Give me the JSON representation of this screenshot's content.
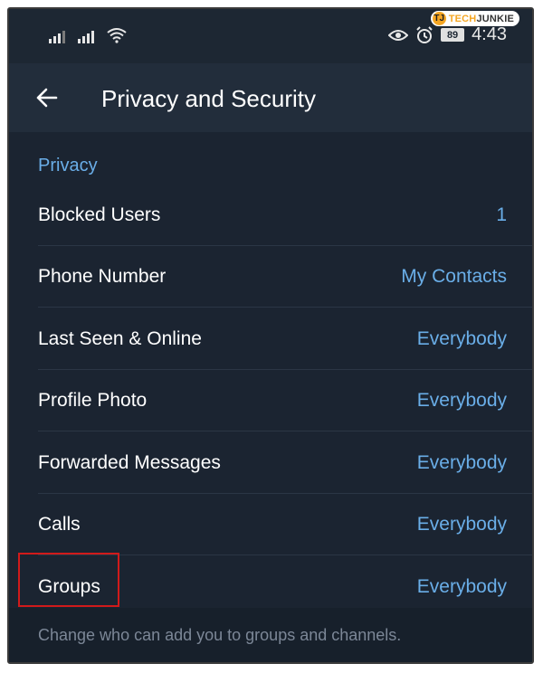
{
  "status_bar": {
    "time": "4:43",
    "battery": "89",
    "icons": [
      "signal-icon",
      "signal-icon",
      "wifi-icon",
      "eye-icon",
      "alarm-icon",
      "battery-icon"
    ]
  },
  "watermark": {
    "prefix": "TECH",
    "suffix": "JUNKIE",
    "mark": "TJ"
  },
  "app_bar": {
    "title": "Privacy and Security",
    "back_icon": "arrow-left-icon"
  },
  "section": {
    "header": "Privacy",
    "items": [
      {
        "label": "Blocked Users",
        "value": "1"
      },
      {
        "label": "Phone Number",
        "value": "My Contacts"
      },
      {
        "label": "Last Seen & Online",
        "value": "Everybody"
      },
      {
        "label": "Profile Photo",
        "value": "Everybody"
      },
      {
        "label": "Forwarded Messages",
        "value": "Everybody"
      },
      {
        "label": "Calls",
        "value": "Everybody"
      },
      {
        "label": "Groups",
        "value": "Everybody"
      }
    ],
    "footer": "Change who can add you to groups and channels."
  },
  "colors": {
    "background": "#1b2431",
    "app_bar": "#222d3b",
    "accent": "#6aaee8",
    "highlight": "#d11a1a"
  }
}
